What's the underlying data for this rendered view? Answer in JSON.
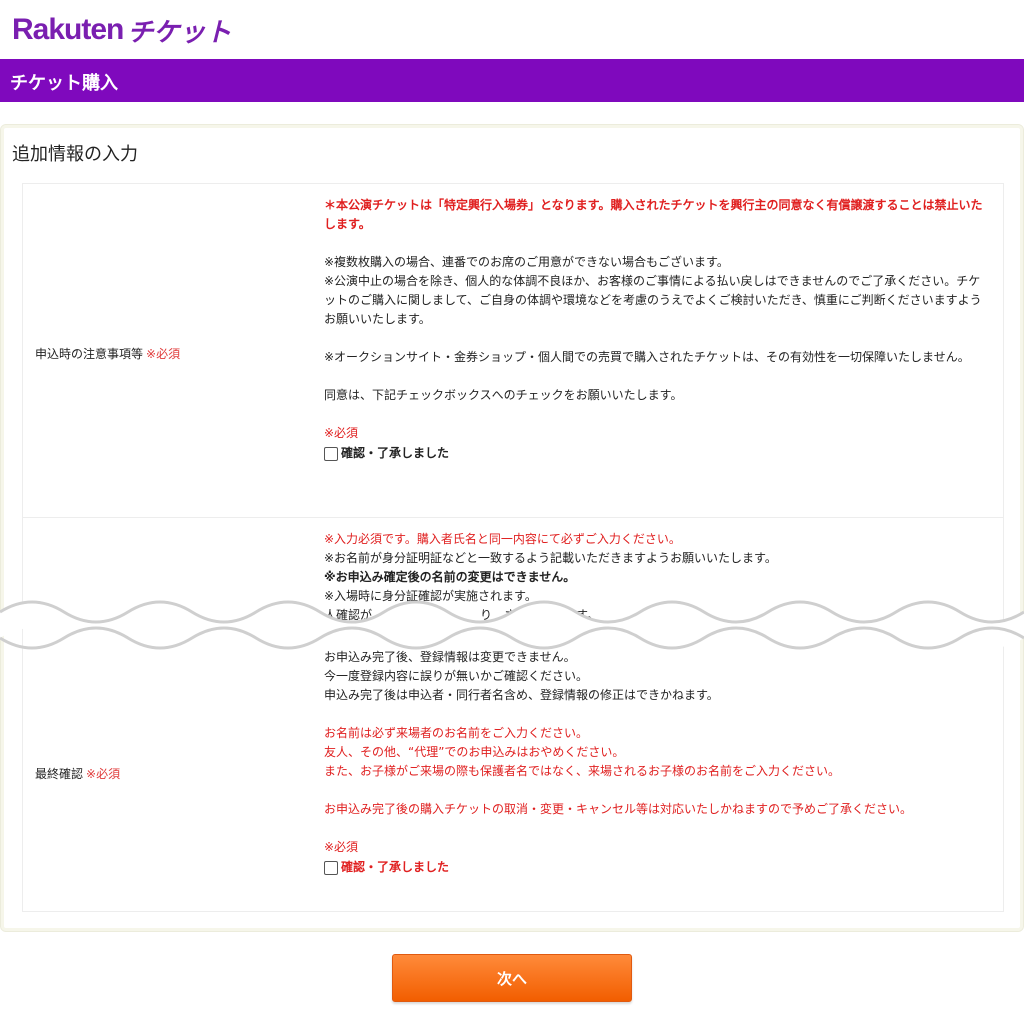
{
  "header": {
    "logo_rakuten": "Rakuten",
    "logo_ticket": "チケット",
    "page_title": "チケット購入"
  },
  "section": {
    "title": "追加情報の入力"
  },
  "row1": {
    "label": "申込時の注意事項等",
    "required": "※必須",
    "notice_bold": "＊本公演チケットは「特定興行入場券」となります。購入されたチケットを興行主の同意なく有償譲渡することは禁止いたします。",
    "p1": "※複数枚購入の場合、連番でのお席のご用意ができない場合もございます。",
    "p2": "※公演中止の場合を除き、個人的な体調不良ほか、お客様のご事情による払い戻しはできませんのでご了承ください。チケットのご購入に関しまして、ご自身の体調や環境などを考慮のうえでよくご検討いただき、慎重にご判断くださいますようお願いいたします。",
    "p3": "※オークションサイト・金券ショップ・個人間での売買で購入されたチケットは、その有効性を一切保障いたしません。",
    "p4": "同意は、下記チェックボックスへのチェックをお願いいたします。",
    "required2": "※必須",
    "checkbox_label": "確認・了承しました",
    "checked": false
  },
  "row2": {
    "label": "最終確認",
    "required": "※必須",
    "l1": "※入力必須です。購入者氏名と同一内容にて必ずご入力ください。",
    "l2": "※お名前が身分証明証などと一致するよう記載いただきますようお願いいたします。",
    "l3": "※お申込み確定後の名前の変更はできません。",
    "l4": "※入場時に身分証確認が実施されます。",
    "l5": "人確認が　　　合には　　　り　させて　　ます。",
    "l6": "お申込み完了後、登録情報は変更できません。",
    "l7": "今一度登録内容に誤りが無いかご確認ください。",
    "l8": "申込み完了後は申込者・同行者名含め、登録情報の修正はできかねます。",
    "l9": "お名前は必ず来場者のお名前をご入力ください。",
    "l10": "友人、その他、“代理”でのお申込みはおやめください。",
    "l11": "また、お子様がご来場の際も保護者名ではなく、来場されるお子様のお名前をご入力ください。",
    "l12": "お申込み完了後の購入チケットの取消・変更・キャンセル等は対応いたしかねますので予めご了承ください。",
    "required2": "※必須",
    "checkbox_label": "確認・了承しました",
    "checked": false
  },
  "actions": {
    "next_label": "次へ"
  },
  "colors": {
    "brand": "#7f09bd",
    "required": "#e03b3b",
    "button": "#f66b0e"
  }
}
